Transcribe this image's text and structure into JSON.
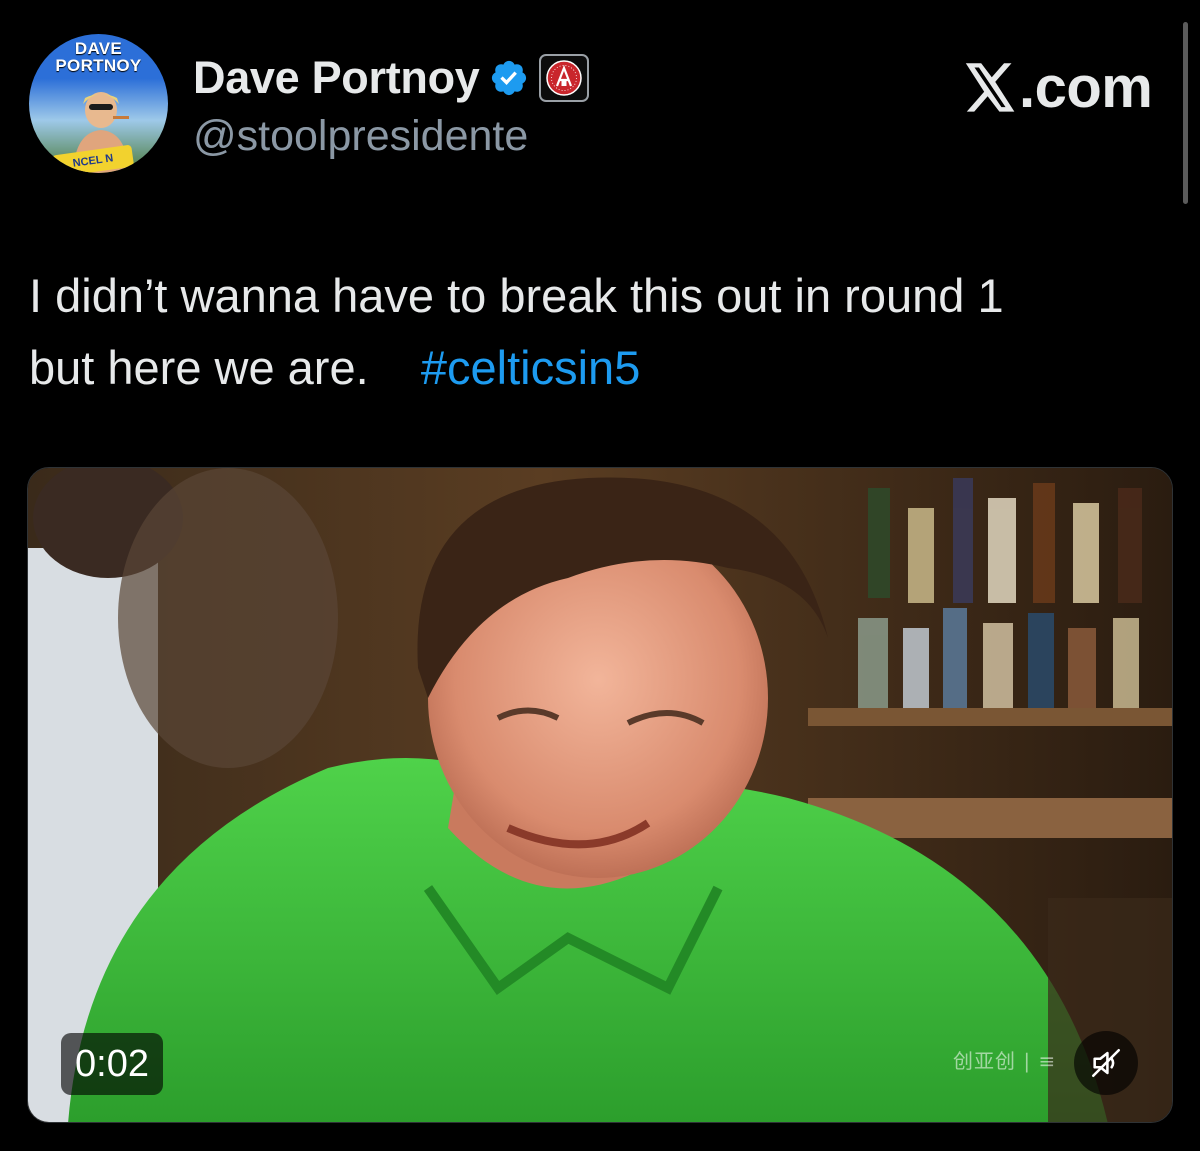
{
  "author": {
    "avatar_banner": [
      "DAVE",
      "PORTNOY"
    ],
    "avatar_ribbon_text": "NCEL N",
    "display_name": "Dave Portnoy",
    "handle": "@stoolpresidente",
    "verified_color": "#1d9bf0",
    "affiliate_badge_icon": "barstool-logo-icon"
  },
  "source": {
    "label": ".com",
    "logo_icon": "x-logo-icon"
  },
  "tweet": {
    "lines": [
      "I didn’t wanna have to break this out in round 1",
      "but here we are.    "
    ],
    "hashtag": "#celticsin5",
    "hashtag_color": "#1d9bf0"
  },
  "media": {
    "kind": "video",
    "duration": "0:02",
    "watermark": "创亚创 | ≡",
    "mute_icon": "speaker-muted-icon"
  },
  "colors": {
    "background": "#000000",
    "text_primary": "#e7e9ea",
    "text_secondary": "#8b98a5",
    "shirt_green": "#3fbf3c"
  }
}
